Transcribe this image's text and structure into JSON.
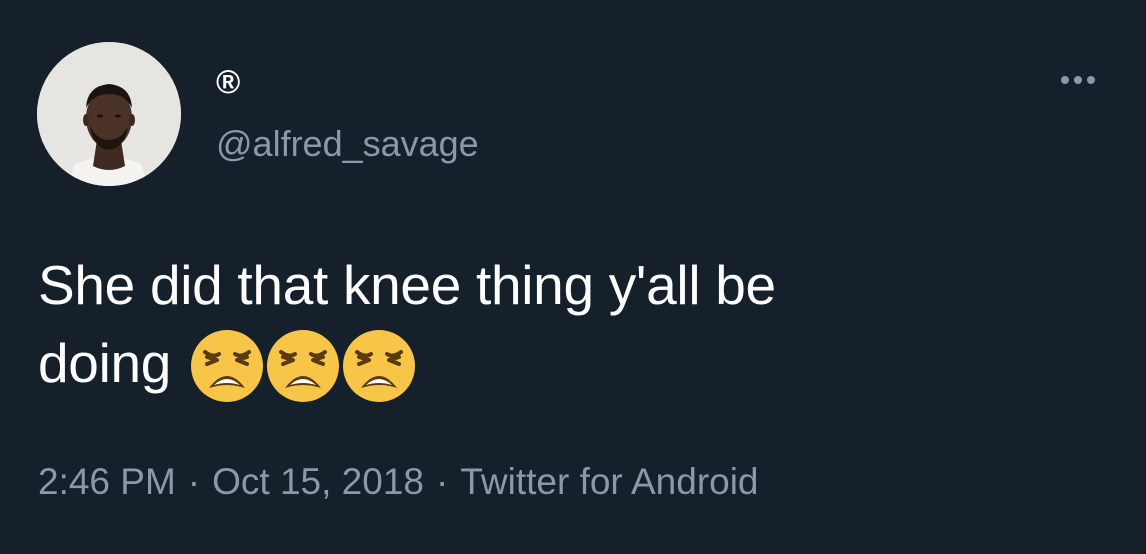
{
  "author": {
    "display_name": "®",
    "handle": "@alfred_savage"
  },
  "icons": {
    "more": "more-horizontal-icon",
    "emoji": "weary-face-emoji"
  },
  "tweet": {
    "text_line1": "She did that knee thing y'all be",
    "text_line2": "doing",
    "emojis": [
      "😩",
      "😩",
      "😩"
    ]
  },
  "meta": {
    "time": "2:46 PM",
    "separator": "·",
    "date": "Oct 15, 2018",
    "source": "Twitter for Android"
  },
  "colors": {
    "background": "#15202b",
    "primary_text": "#ffffff",
    "secondary_text": "#8b98a5",
    "emoji_yellow": "#f7c548"
  }
}
